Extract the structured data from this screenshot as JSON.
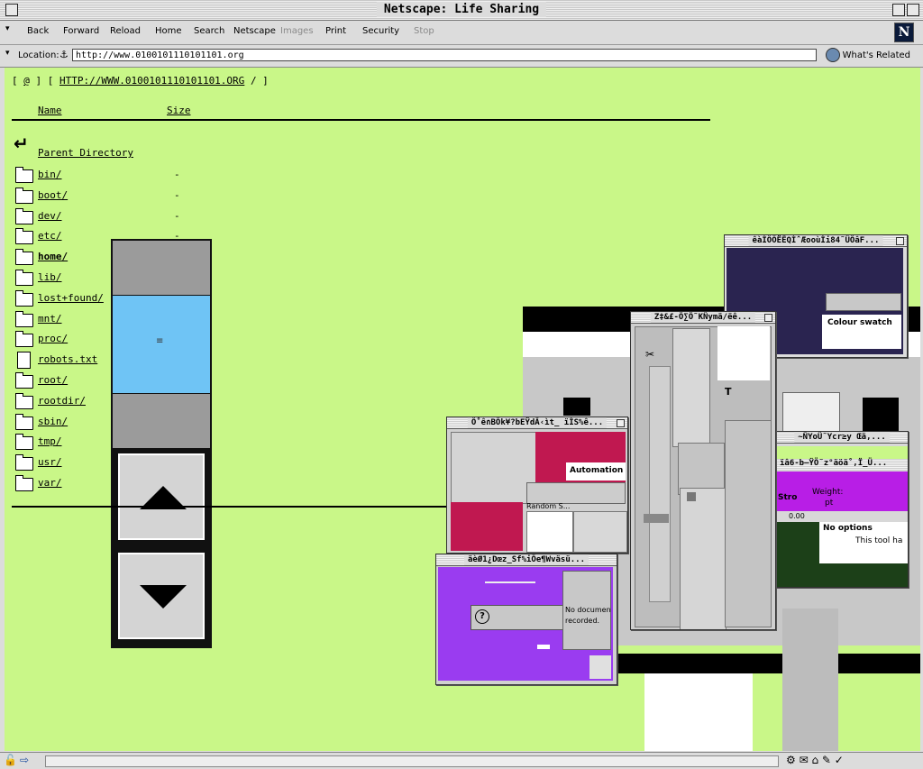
{
  "window": {
    "title": "Netscape: Life Sharing"
  },
  "toolbar": {
    "back": "Back",
    "forward": "Forward",
    "reload": "Reload",
    "home": "Home",
    "search": "Search",
    "netscape": "Netscape",
    "images": "Images",
    "print": "Print",
    "security": "Security",
    "stop": "Stop",
    "logo_letter": "N"
  },
  "location": {
    "label": "Location:",
    "url": "http://www.0100101110101101.org",
    "related": "What's Related"
  },
  "page": {
    "breadcrumb_open": "[",
    "breadcrumb_at": "@",
    "breadcrumb_mid": "] [",
    "breadcrumb_link": "HTTP://WWW.0100101110101101.ORG",
    "breadcrumb_close": "/ ]",
    "col_name": "Name",
    "col_size": "Size",
    "parent_label": "Parent Directory",
    "size_dash": "-",
    "entries": [
      {
        "name": "bin/",
        "size": "-",
        "kind": "folder"
      },
      {
        "name": "boot/",
        "size": "-",
        "kind": "folder"
      },
      {
        "name": "dev/",
        "size": "-",
        "kind": "folder"
      },
      {
        "name": "etc/",
        "size": "-",
        "kind": "folder"
      },
      {
        "name": "home/",
        "size": "-",
        "kind": "folder"
      },
      {
        "name": "lib/",
        "size": "-",
        "kind": "folder"
      },
      {
        "name": "lost+found/",
        "size": "-",
        "kind": "folder"
      },
      {
        "name": "mnt/",
        "size": "-",
        "kind": "folder"
      },
      {
        "name": "proc/",
        "size": "-",
        "kind": "folder"
      },
      {
        "name": "robots.txt",
        "size": "-",
        "kind": "file"
      },
      {
        "name": "root/",
        "size": "-",
        "kind": "folder"
      },
      {
        "name": "rootdir/",
        "size": "-",
        "kind": "folder"
      },
      {
        "name": "sbin/",
        "size": "-",
        "kind": "folder"
      },
      {
        "name": "tmp/",
        "size": "-",
        "kind": "folder"
      },
      {
        "name": "usr/",
        "size": "-",
        "kind": "folder"
      },
      {
        "name": "var/",
        "size": "-",
        "kind": "folder"
      }
    ],
    "scroll_thumb_glyph": "≡"
  },
  "windows": {
    "colour": {
      "title": "êàÌÖÖËÊQÌˆÆooùÌi84˜ÜÖâF...",
      "label": "Colour swatch"
    },
    "tools": {
      "title": "Z‡&£-Ö∑Ö˜KÑymä/ëê...",
      "scissors": "✂",
      "text_tool": "T"
    },
    "automation": {
      "title": "Ö˚ê∩BÖk¥?bEŸdÂ‹ìt_ ïÌS%ê...",
      "label": "Automation",
      "random": "Random S..."
    },
    "weight": {
      "title_a": "~ÑYoÜ˜Ycr≥y Œä,...",
      "title_b": "ïâ6-b–ŸÖ˜z°äöä˚,Ï_Ü...",
      "label": "Weight:",
      "unit": "pt",
      "left_text": "Stro",
      "extra": "0.00"
    },
    "options": {
      "label": "No options",
      "sublabel": "This tool ha"
    },
    "history": {
      "title": "äèØ1¿Dœz_Sf%iÖe¶Wväsü...",
      "label_a": "No documen",
      "label_b": "recorded.",
      "help": "?"
    }
  },
  "colors": {
    "page_bg": "#c9f788",
    "scroll_blue": "#6fc4f5",
    "scroll_gray": "#9b9b9b",
    "navy": "#2a2450",
    "crimson": "#c01850",
    "violet": "#9a3cf0",
    "magenta": "#b81ee6",
    "dark_green": "#1c4018"
  }
}
